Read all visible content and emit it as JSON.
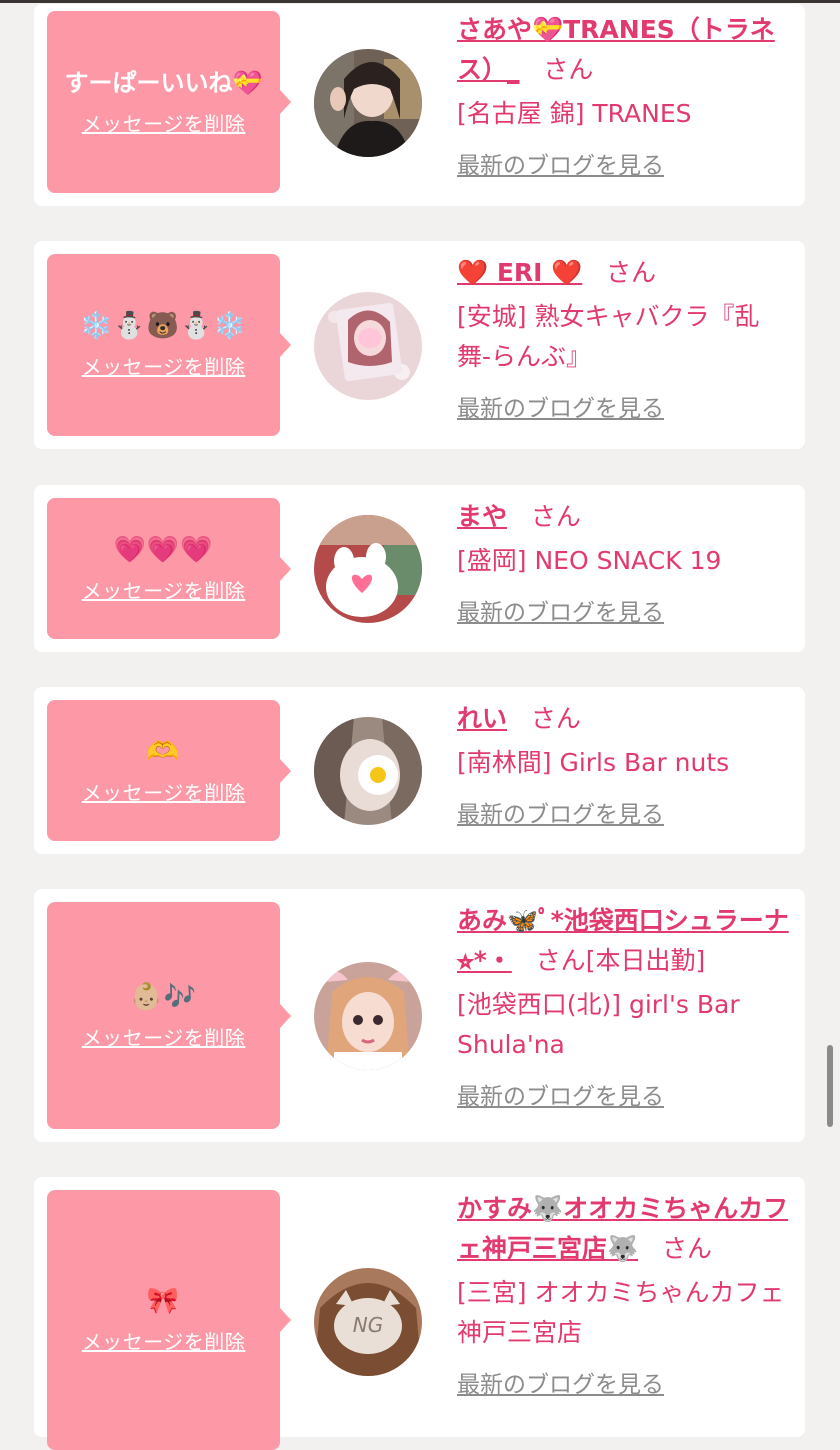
{
  "colors": {
    "page_bg": "#f3f1ef",
    "card_bg": "#ffffff",
    "bubble_bg": "#fd98a7",
    "name_color": "#e23a6e",
    "blog_link_color": "#8c8c8c"
  },
  "cards": [
    {
      "message": "すーぱーいいね💝",
      "delete_label": "メッセージを削除",
      "name": "さあや💝TRANES（トラネス）_",
      "honorific": "さん",
      "extra": "",
      "shop": "[名古屋 錦] TRANES",
      "blog_label": "最新のブログを見る"
    },
    {
      "message": "❄️⛄️🐻⛄️❄️",
      "delete_label": "メッセージを削除",
      "name": "❤️ ERI ❤️",
      "honorific": "さん",
      "extra": "",
      "shop": "[安城] 熟女キャバクラ『乱舞-らんぶ』",
      "blog_label": "最新のブログを見る"
    },
    {
      "message": "💗💗💗",
      "delete_label": "メッセージを削除",
      "name": "まや",
      "honorific": "さん",
      "extra": "",
      "shop": "[盛岡] NEO SNACK 19",
      "blog_label": "最新のブログを見る"
    },
    {
      "message": "🫶",
      "delete_label": "メッセージを削除",
      "name": "れい",
      "honorific": "さん",
      "extra": "",
      "shop": "[南林間] Girls Bar nuts",
      "blog_label": "最新のブログを見る"
    },
    {
      "message": "👶🏼🎶",
      "delete_label": "メッセージを削除",
      "name": "あみ🦋ﾟ*池袋西口シュラーナ⭐︎*・",
      "honorific": "さん",
      "extra": "[本日出勤]",
      "shop": "[池袋西口(北)] girl's Bar Shula'na",
      "blog_label": "最新のブログを見る"
    },
    {
      "message": "🎀",
      "delete_label": "メッセージを削除",
      "name": "かすみ🐺オオカミちゃんカフェ神戸三宮店🐺",
      "honorific": "さん",
      "extra": "",
      "shop": "[三宮] オオカミちゃんカフェ神戸三宮店",
      "blog_label": "最新のブログを見る"
    }
  ]
}
